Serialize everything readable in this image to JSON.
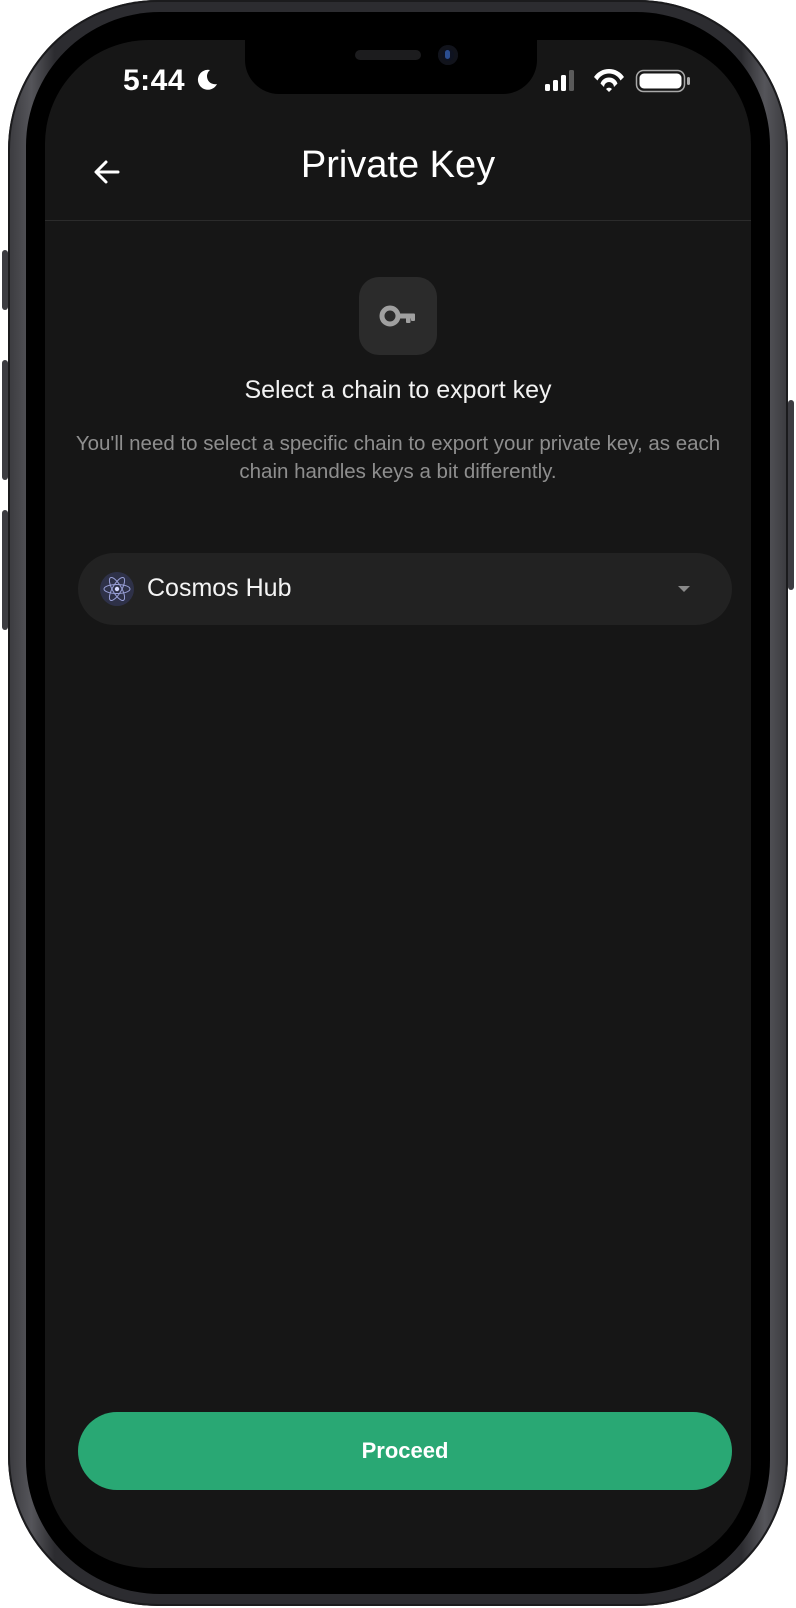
{
  "status_bar": {
    "time": "5:44",
    "moon_icon": "moon-icon",
    "signal_icon": "cellular-signal-icon",
    "wifi_icon": "wifi-icon",
    "battery_icon": "battery-icon"
  },
  "header": {
    "title": "Private Key",
    "back_icon": "arrow-left-icon"
  },
  "intro": {
    "icon": "key-icon",
    "heading": "Select a chain to export key",
    "description": "You'll need to select a specific chain to export your private key, as each chain handles keys a bit differently."
  },
  "chain_selector": {
    "selected": "Cosmos Hub",
    "logo_icon": "cosmos-atom-icon",
    "chevron_icon": "chevron-down-icon"
  },
  "footer": {
    "proceed_label": "Proceed"
  },
  "colors": {
    "background": "#161616",
    "surface": "#222222",
    "accent": "#29a874",
    "text_primary": "#ffffff",
    "text_secondary": "#8e8e8e"
  }
}
